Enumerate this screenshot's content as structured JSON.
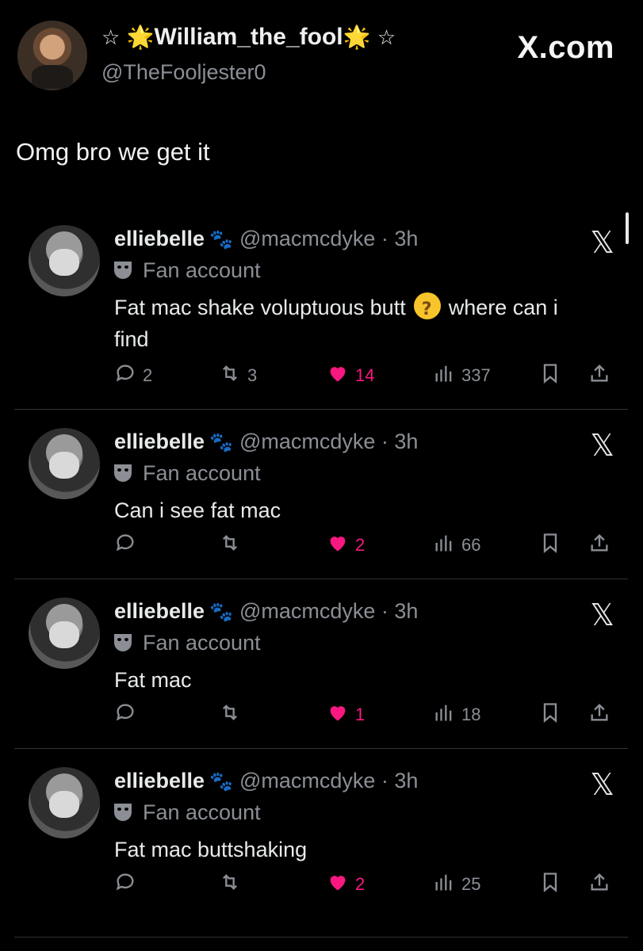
{
  "header": {
    "display_name": "William_the_fool",
    "star_outline": "☆",
    "star_glow": "🌟",
    "handle": "@TheFooljester0",
    "brand": "X.com"
  },
  "quote_text": "Omg bro we get it",
  "colors": {
    "background": "#000000",
    "like": "#f91880",
    "muted": "#8b8f95"
  },
  "replies": [
    {
      "name": "elliebelle",
      "paws": "🐾",
      "handle": "@macmcdyke · 3h",
      "badge": "Fan account",
      "text_before": "Fat mac shake voluptuous butt",
      "emoji": "🤔",
      "text_after": "where can i find",
      "replies_count": "2",
      "reposts_count": "3",
      "likes_count": "14",
      "views_count": "337"
    },
    {
      "name": "elliebelle",
      "paws": "🐾",
      "handle": "@macmcdyke · 3h",
      "badge": "Fan account",
      "text_before": "Can i see fat mac",
      "emoji": "",
      "text_after": "",
      "replies_count": "",
      "reposts_count": "",
      "likes_count": "2",
      "views_count": "66"
    },
    {
      "name": "elliebelle",
      "paws": "🐾",
      "handle": "@macmcdyke · 3h",
      "badge": "Fan account",
      "text_before": "Fat mac",
      "emoji": "",
      "text_after": "",
      "replies_count": "",
      "reposts_count": "",
      "likes_count": "1",
      "views_count": "18"
    },
    {
      "name": "elliebelle",
      "paws": "🐾",
      "handle": "@macmcdyke · 3h",
      "badge": "Fan account",
      "text_before": "Fat mac buttshaking",
      "emoji": "",
      "text_after": "",
      "replies_count": "",
      "reposts_count": "",
      "likes_count": "2",
      "views_count": "25"
    }
  ],
  "icons": {
    "close": "x-logo-icon",
    "reply": "reply-bubble-icon",
    "repost": "repost-arrows-icon",
    "like": "heart-icon",
    "views": "views-bars-icon",
    "bookmark": "bookmark-icon",
    "share": "share-upload-icon"
  }
}
